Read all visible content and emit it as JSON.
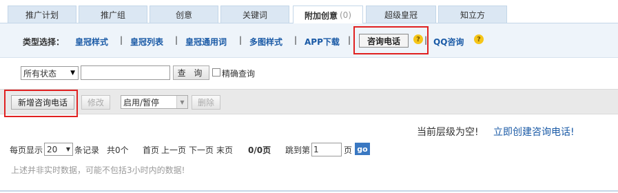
{
  "tabs": [
    {
      "label": "推广计划"
    },
    {
      "label": "推广组"
    },
    {
      "label": "创意"
    },
    {
      "label": "关键词"
    },
    {
      "label": "附加创意",
      "count": "(0)",
      "active": true
    },
    {
      "label": "超级皇冠"
    },
    {
      "label": "知立方"
    }
  ],
  "type_selector": {
    "label": "类型选择：",
    "items": [
      "皇冠样式",
      "皇冠列表",
      "皇冠通用词",
      "多图样式",
      "APP下载"
    ],
    "separator": "|",
    "selected": "咨询电话",
    "after": "QQ咨询",
    "help_icon": "?"
  },
  "filter": {
    "status_value": "所有状态",
    "search_value": "",
    "search_button": "查 询",
    "exact_label": "精确查询",
    "exact_checked": false
  },
  "toolbar": {
    "add_button": "新增咨询电话",
    "edit_button": "修改",
    "state_select": "启用/暂停",
    "delete_button": "删除"
  },
  "empty_state": {
    "message": "当前层级为空!",
    "create_link": "立即创建咨询电话!"
  },
  "pagination": {
    "per_page_prefix": "每页显示",
    "per_page_value": "20",
    "per_page_suffix": "条记录",
    "total": "共0个",
    "first": "首页",
    "prev": "上一页",
    "next": "下一页",
    "last": "末页",
    "page_info": "0/0页",
    "jump_prefix": "跳到第",
    "jump_value": "1",
    "jump_suffix": "页",
    "go": "go"
  },
  "note": "上述并非实时数据，可能不包括3小时内的数据!",
  "colors": {
    "link": "#1a5aa6",
    "highlight": "#e02020",
    "tab_bg": "#dbe7f3",
    "help": "#f5c518"
  }
}
